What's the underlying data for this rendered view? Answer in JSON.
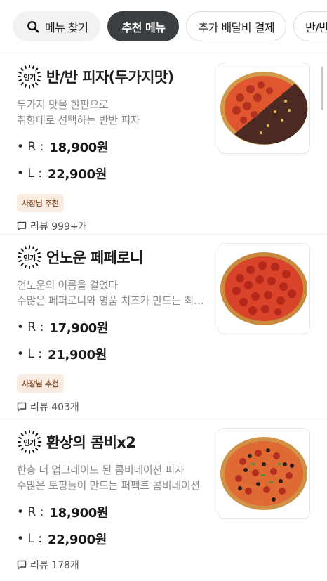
{
  "chips": {
    "search_label": "메뉴 찾기",
    "active_label": "추천 메뉴",
    "chip3_label": "추가 배달비 결제",
    "chip4_label": "반/반 피자"
  },
  "hot_badge": "인기",
  "colors": {
    "active_chip": "#3c3f41",
    "owner_badge_bg": "#f8ece3",
    "owner_badge_text": "#8c5a3c"
  },
  "items": [
    {
      "title": "반/반 피자(두가지맛)",
      "desc_line1": "두가지 맛을 한판으로",
      "desc_line2": "취향대로 선택하는 반반 피자",
      "price_r_label": "• R :",
      "price_r": "18,900원",
      "price_l_label": "• L :",
      "price_l": "22,900원",
      "owner_badge": "사장님 추천",
      "reviews": "리뷰 999+개",
      "image": "half-half-pizza"
    },
    {
      "title": "언노운 페페로니",
      "desc_line1": "언노운의 이름을 걸었다",
      "desc_line2": "수많은 페퍼로니와 명품 치즈가 만드는 최…",
      "price_r_label": "• R :",
      "price_r": "17,900원",
      "price_l_label": "• L :",
      "price_l": "21,900원",
      "owner_badge": "사장님 추천",
      "reviews": "리뷰 403개",
      "image": "pepperoni-pizza"
    },
    {
      "title": "환상의 콤비x2",
      "desc_line1": "한층 더 업그레이드 된 콤비네이션 피자",
      "desc_line2": "수많은 토핑들이 만드는 퍼펙트 콤비네이션",
      "price_r_label": "• R :",
      "price_r": "18,900원",
      "price_l_label": "• L :",
      "price_l": "22,900원",
      "reviews": "리뷰 178개",
      "image": "combination-pizza"
    }
  ]
}
